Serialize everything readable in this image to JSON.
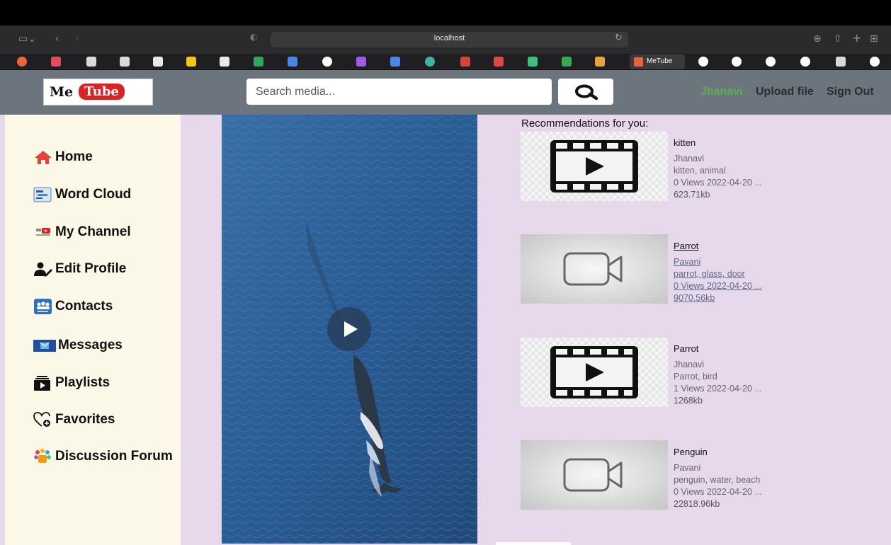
{
  "browser": {
    "url": "localhost",
    "active_tab_label": "MeTube"
  },
  "header": {
    "logo_me": "Me",
    "logo_tube": "Tube",
    "search_placeholder": "Search media...",
    "user_name": "Jhanavi",
    "upload_label": "Upload file",
    "signout_label": "Sign Out"
  },
  "sidebar": {
    "items": [
      {
        "label": "Home",
        "icon": "home-icon"
      },
      {
        "label": "Word Cloud",
        "icon": "word-cloud-icon"
      },
      {
        "label": "My Channel",
        "icon": "channel-icon"
      },
      {
        "label": "Edit Profile",
        "icon": "edit-profile-icon"
      },
      {
        "label": "Contacts",
        "icon": "contacts-icon"
      },
      {
        "label": "Messages",
        "icon": "messages-icon"
      },
      {
        "label": "Playlists",
        "icon": "playlists-icon"
      },
      {
        "label": "Favorites",
        "icon": "favorites-icon"
      },
      {
        "label": "Discussion Forum",
        "icon": "forum-icon"
      }
    ]
  },
  "recommendations": {
    "title": "Recommendations for you:",
    "items": [
      {
        "name": "kitten",
        "user": "Jhanavi",
        "tags": "kitten, animal",
        "meta": "0 Views 2022-04-20 ...",
        "size": "623.71kb"
      },
      {
        "name": "Parrot",
        "user": "Pavani",
        "tags": "parrot, glass, door",
        "meta": "0 Views 2022-04-20 ...",
        "size": "9070.56kb"
      },
      {
        "name": "Parrot",
        "user": "Jhanavi",
        "tags": "Parrot, bird",
        "meta": "1 Views 2022-04-20 ...",
        "size": "1268kb"
      },
      {
        "name": "Penguin",
        "user": "Pavani",
        "tags": "penguin, water, beach",
        "meta": "0 Views 2022-04-20 ...",
        "size": "22818.96kb"
      }
    ]
  },
  "colors": {
    "header_bg": "#6c757d",
    "sidebar_bg": "#fcf8e8",
    "page_bg": "#e8d8ec",
    "user_name": "#58b24a",
    "logo_red": "#e02121"
  }
}
